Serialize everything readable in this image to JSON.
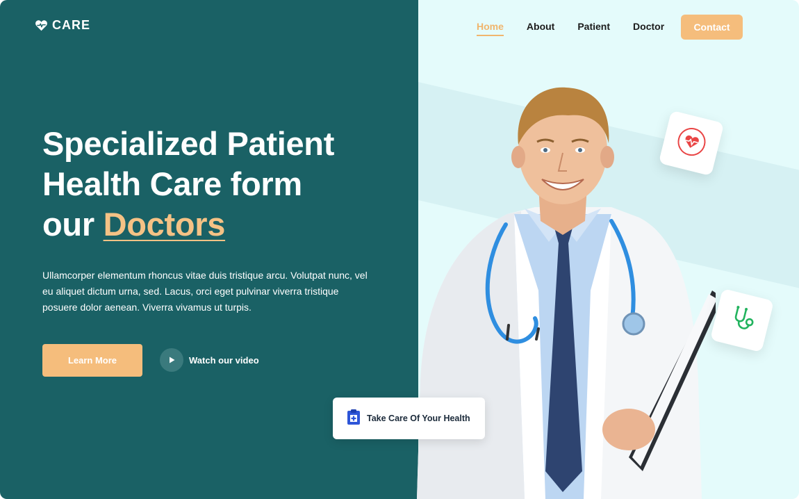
{
  "brand": {
    "name": "CARE",
    "icon": "heart-pulse-icon"
  },
  "nav": {
    "items": [
      {
        "label": "Home",
        "active": true
      },
      {
        "label": "About",
        "active": false
      },
      {
        "label": "Patient",
        "active": false
      },
      {
        "label": "Doctor",
        "active": false
      }
    ],
    "contact_label": "Contact"
  },
  "hero": {
    "title_line1": "Specialized Patient",
    "title_line2": "Health Care form",
    "title_line3_prefix": "our ",
    "title_highlight": "Doctors",
    "description": "Ullamcorper elementum rhoncus vitae duis tristique arcu. Volutpat nunc, vel eu aliquet dictum urna, sed. Lacus, orci eget pulvinar viverra tristique posuere dolor aenean. Viverra vivamus ut turpis.",
    "learn_more_label": "Learn More",
    "watch_video_label": "Watch our video"
  },
  "floating_cards": {
    "heart_icon": "heart-monitor-icon",
    "stethoscope_icon": "stethoscope-icon",
    "health_label": "Take Care Of Your Health",
    "health_icon": "clipboard-medical-icon"
  },
  "colors": {
    "primary_dark": "#1a6165",
    "accent": "#f5bd7c",
    "light_bg": "#e4fbfb"
  }
}
